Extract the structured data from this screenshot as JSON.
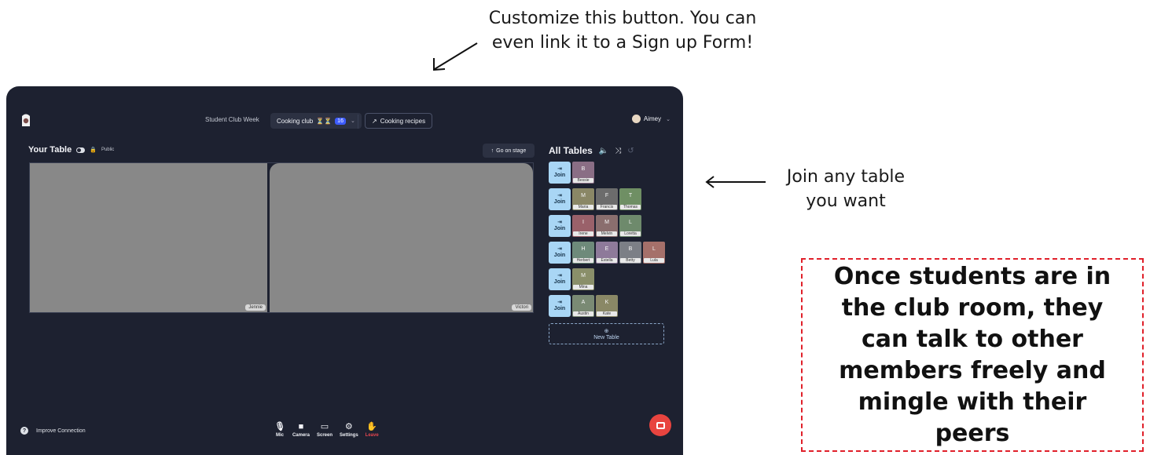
{
  "annotations": {
    "top": "Customize this button. You can even link it to a Sign up Form!",
    "right": "Join any table you want",
    "callout": "Once students are in the club room, they can talk to other members freely and mingle with their peers",
    "callout_color": "#e0202a"
  },
  "header": {
    "event_name": "Student Club Week",
    "room_name": "Cooking club",
    "room_emoji": "⏳⏳",
    "participant_count": "16",
    "link_button": "Cooking recipes",
    "user_name": "Aimey"
  },
  "your_table": {
    "title": "Your Table",
    "visibility": "Public",
    "go_on_stage": "Go on stage",
    "participants": [
      "Jennie",
      "Victori"
    ]
  },
  "all_tables": {
    "title": "All Tables",
    "join_label": "Join",
    "new_table_label": "New Table",
    "tables": [
      [
        {
          "initial": "B",
          "name": "Bessie",
          "color": "#8a6e85"
        }
      ],
      [
        {
          "initial": "M",
          "name": "Maria",
          "color": "#8a8766"
        },
        {
          "initial": "F",
          "name": "Francis",
          "color": "#6c6c6c"
        },
        {
          "initial": "T",
          "name": "Thomas",
          "color": "#6f8f64"
        }
      ],
      [
        {
          "initial": "I",
          "name": "Irene",
          "color": "#9a616a"
        },
        {
          "initial": "M",
          "name": "Melvin",
          "color": "#8a6e6e"
        },
        {
          "initial": "L",
          "name": "Loretta",
          "color": "#6e8a6c"
        }
      ],
      [
        {
          "initial": "H",
          "name": "Herbert",
          "color": "#6e8a7a"
        },
        {
          "initial": "E",
          "name": "Estella",
          "color": "#8e7a9a"
        },
        {
          "initial": "B",
          "name": "Betty",
          "color": "#7c7f86"
        },
        {
          "initial": "L",
          "name": "Lula",
          "color": "#a5706a"
        }
      ],
      [
        {
          "initial": "M",
          "name": "Mina",
          "color": "#8a8f6a"
        }
      ],
      [
        {
          "initial": "A",
          "name": "Austin",
          "color": "#7a8a74"
        },
        {
          "initial": "K",
          "name": "Kate",
          "color": "#8a8866"
        }
      ]
    ]
  },
  "bottom": {
    "help_label": "Improve Connection",
    "controls": [
      "Mic",
      "Camera",
      "Screen",
      "Settings",
      "Leave"
    ]
  },
  "colors": {
    "app_bg": "#1d2130",
    "join_bg": "#a9d6f5",
    "leave": "#e2454f",
    "chat_fab": "#e8443f",
    "video_tile": "#888888"
  }
}
